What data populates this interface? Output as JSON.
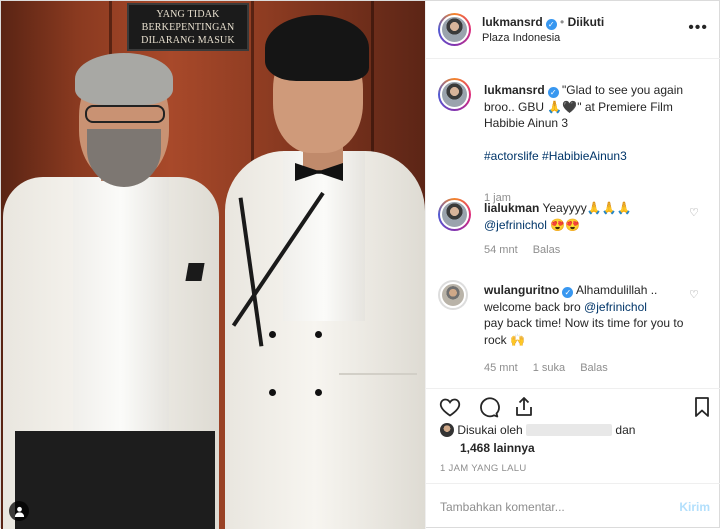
{
  "photo": {
    "sign_lines": [
      "YANG TIDAK",
      "BERKEPENTINGAN",
      "DILARANG MASUK"
    ],
    "tag_icon": "person-tag-icon"
  },
  "header": {
    "username": "lukmansrd",
    "separator": "•",
    "follow_label": "Diikuti",
    "location": "Plaza Indonesia",
    "more_icon": "more-options-icon"
  },
  "caption": {
    "username": "lukmansrd",
    "text": "\"Glad to see you again broo.. GBU 🙏🖤\" at Premiere Film Habibie Ainun 3",
    "hashtags": "#actorslife #HabibieAinun3",
    "time": "1 jam"
  },
  "comments": [
    {
      "username": "lialukman",
      "text": "Yeayyyy🙏🙏🙏",
      "mention": "@jefrinichol",
      "tail": " 😍😍",
      "time": "54 mnt",
      "reply": "Balas",
      "likes": ""
    },
    {
      "username": "wulanguritno",
      "text": "Alhamdulillah ..",
      "line2_pre": "welcome back bro ",
      "mention": "@jefrinichol",
      "line3": "pay back time! Now its time for you to rock 🙌",
      "time": "45 mnt",
      "likes": "1 suka",
      "reply": "Balas"
    }
  ],
  "likes": {
    "prefix": "Disukai oleh",
    "suffix": "dan",
    "count": "1,468 lainnya"
  },
  "timestamp": "1 JAM YANG LALU",
  "composer": {
    "placeholder": "Tambahkan komentar...",
    "send_label": "Kirim"
  },
  "colors": {
    "verified": "#3897f0",
    "link": "#003569",
    "muted": "#8e8e8e",
    "send_disabled": "#b2dffc"
  }
}
